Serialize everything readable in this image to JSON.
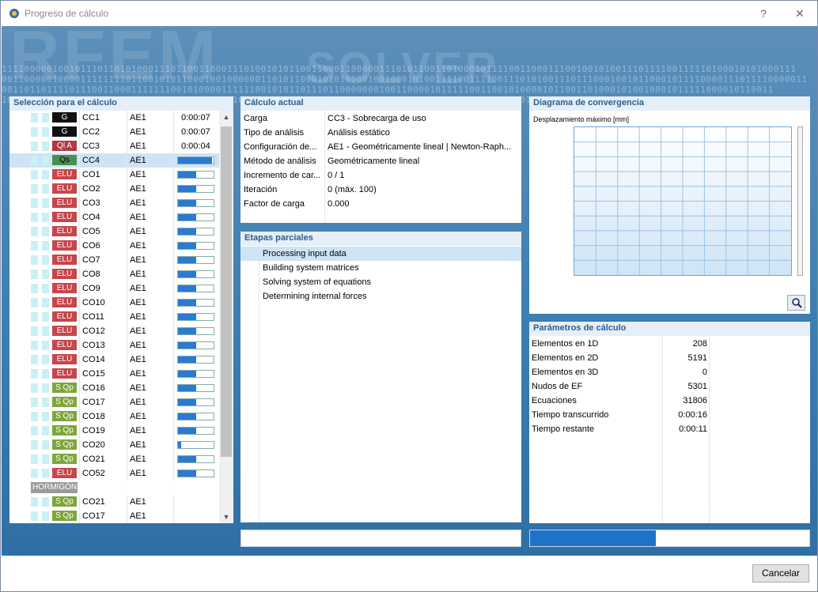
{
  "window": {
    "title": "Progreso de cálculo",
    "help": "?",
    "close": "✕"
  },
  "background": {
    "word1": "RFEM",
    "word2": "SOLVER",
    "binary": [
      "111100000100101110110101000111011001100011101001010110011000110000011101011001101000101111001100011100100101001110111100111110100010101000111",
      "00110000010000111111110110010101100010010000001101011000101010000100100010100111100111100111010100111011100010010110001011110000111011110000011",
      "00110110111101110011000111111100101000011111100101011011101100000001001100001011111001100101000010110011010001010010001011111000010110011",
      "10110101011101101000011011101011000101010100110001100010011010110001110101100110010101000011011011000011111010101111011011110111100001010101001"
    ]
  },
  "left": {
    "title": "Selección para el cálculo",
    "rows": [
      {
        "badge": "G",
        "cls": "b-G",
        "code": "CC1",
        "ae": "AE1",
        "time": "0:00:07"
      },
      {
        "badge": "G",
        "cls": "b-G",
        "code": "CC2",
        "ae": "AE1",
        "time": "0:00:07"
      },
      {
        "badge": "Ql A",
        "cls": "b-QIA",
        "code": "CC3",
        "ae": "AE1",
        "time": "0:00:04"
      },
      {
        "badge": "Qs",
        "cls": "b-Qs",
        "code": "CC4",
        "ae": "AE1",
        "progress": 0.95,
        "sel": true
      },
      {
        "badge": "ELU",
        "cls": "b-ELU",
        "code": "CO1",
        "ae": "AE1",
        "progress": 0.5
      },
      {
        "badge": "ELU",
        "cls": "b-ELU",
        "code": "CO2",
        "ae": "AE1",
        "progress": 0.5
      },
      {
        "badge": "ELU",
        "cls": "b-ELU",
        "code": "CO3",
        "ae": "AE1",
        "progress": 0.5
      },
      {
        "badge": "ELU",
        "cls": "b-ELU",
        "code": "CO4",
        "ae": "AE1",
        "progress": 0.5
      },
      {
        "badge": "ELU",
        "cls": "b-ELU",
        "code": "CO5",
        "ae": "AE1",
        "progress": 0.5
      },
      {
        "badge": "ELU",
        "cls": "b-ELU",
        "code": "CO6",
        "ae": "AE1",
        "progress": 0.5
      },
      {
        "badge": "ELU",
        "cls": "b-ELU",
        "code": "CO7",
        "ae": "AE1",
        "progress": 0.5
      },
      {
        "badge": "ELU",
        "cls": "b-ELU",
        "code": "CO8",
        "ae": "AE1",
        "progress": 0.5
      },
      {
        "badge": "ELU",
        "cls": "b-ELU",
        "code": "CO9",
        "ae": "AE1",
        "progress": 0.5
      },
      {
        "badge": "ELU",
        "cls": "b-ELU",
        "code": "CO10",
        "ae": "AE1",
        "progress": 0.5
      },
      {
        "badge": "ELU",
        "cls": "b-ELU",
        "code": "CO11",
        "ae": "AE1",
        "progress": 0.5
      },
      {
        "badge": "ELU",
        "cls": "b-ELU",
        "code": "CO12",
        "ae": "AE1",
        "progress": 0.5
      },
      {
        "badge": "ELU",
        "cls": "b-ELU",
        "code": "CO13",
        "ae": "AE1",
        "progress": 0.5
      },
      {
        "badge": "ELU",
        "cls": "b-ELU",
        "code": "CO14",
        "ae": "AE1",
        "progress": 0.5
      },
      {
        "badge": "ELU",
        "cls": "b-ELU",
        "code": "CO15",
        "ae": "AE1",
        "progress": 0.5
      },
      {
        "badge": "S Qp",
        "cls": "b-SQp",
        "code": "CO16",
        "ae": "AE1",
        "progress": 0.5
      },
      {
        "badge": "S Qp",
        "cls": "b-SQp",
        "code": "CO17",
        "ae": "AE1",
        "progress": 0.5
      },
      {
        "badge": "S Qp",
        "cls": "b-SQp",
        "code": "CO18",
        "ae": "AE1",
        "progress": 0.5
      },
      {
        "badge": "S Qp",
        "cls": "b-SQp",
        "code": "CO19",
        "ae": "AE1",
        "progress": 0.5
      },
      {
        "badge": "S Qp",
        "cls": "b-SQp",
        "code": "CO20",
        "ae": "AE1",
        "progress": 0.08
      },
      {
        "badge": "S Qp",
        "cls": "b-SQp",
        "code": "CO21",
        "ae": "AE1",
        "progress": 0.5
      },
      {
        "badge": "ELU",
        "cls": "b-ELU",
        "code": "CO52",
        "ae": "AE1",
        "progress": 0.5
      },
      {
        "group": "HORMIGÓN"
      },
      {
        "badge": "S Qp",
        "cls": "b-SQp",
        "code": "CO21",
        "ae": "AE1"
      },
      {
        "badge": "S Qp",
        "cls": "b-SQp",
        "code": "CO17",
        "ae": "AE1"
      }
    ]
  },
  "current": {
    "title": "Cálculo actual",
    "rows": [
      {
        "k": "Carga",
        "v": "CC3 - Sobrecarga de uso"
      },
      {
        "k": "Tipo de análisis",
        "v": "Análisis estático"
      },
      {
        "k": "Configuración de...",
        "v": "AE1 - Geométricamente lineal | Newton-Raph..."
      },
      {
        "k": "Método de análisis",
        "v": "Geométricamente lineal"
      },
      {
        "k": "Incremento de car...",
        "v": "0 / 1"
      },
      {
        "k": "Iteración",
        "v": "0 (máx. 100)"
      },
      {
        "k": "Factor de carga",
        "v": "0.000"
      }
    ]
  },
  "stages": {
    "title": "Etapas parciales",
    "items": [
      "Processing input data",
      "Building system matrices",
      "Solving system of equations",
      "Determining internal forces"
    ]
  },
  "convergence": {
    "title": "Diagrama de convergencia",
    "ylabel": "Desplazamiento máximo [mm]"
  },
  "params": {
    "title": "Parámetros de cálculo",
    "rows": [
      {
        "k": "Elementos en 1D",
        "v": "208"
      },
      {
        "k": "Elementos en 2D",
        "v": "5191"
      },
      {
        "k": "Elementos en 3D",
        "v": "0"
      },
      {
        "k": "Nudos de EF",
        "v": "5301"
      },
      {
        "k": "Ecuaciones",
        "v": "31806"
      },
      {
        "k": "Tiempo transcurrido",
        "v": "0:00:16"
      },
      {
        "k": "Tiempo restante",
        "v": "0:00:11"
      }
    ]
  },
  "overall_progress": {
    "left": 0.0,
    "right": 0.45
  },
  "buttons": {
    "cancel": "Cancelar"
  }
}
